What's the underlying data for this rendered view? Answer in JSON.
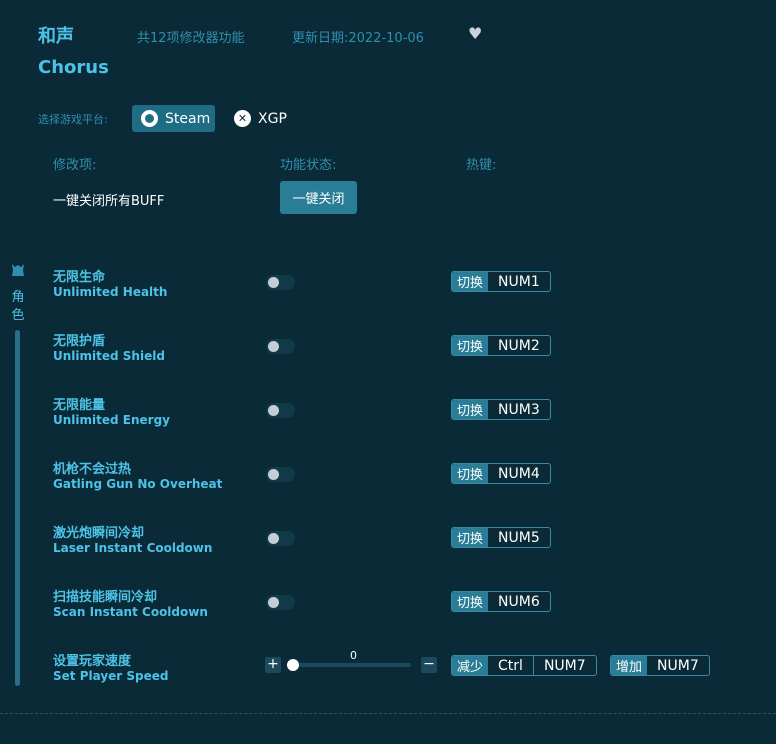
{
  "header": {
    "title_cn": "和声",
    "title_en": "Chorus",
    "feature_count": "共12项修改器功能",
    "update_date": "更新日期:2022-10-06",
    "favorite_icon": "heart-icon"
  },
  "platform": {
    "label": "选择游戏平台:",
    "options": [
      {
        "label": "Steam",
        "icon": "steam-icon",
        "selected": true
      },
      {
        "label": "XGP",
        "icon": "xbox-icon",
        "selected": false
      }
    ]
  },
  "columns": {
    "option": "修改项:",
    "status": "功能状态:",
    "hotkey": "热键:"
  },
  "global": {
    "label": "一键关闭所有BUFF",
    "button": "一键关闭"
  },
  "sidebar": {
    "icon": "character-icon",
    "label_1": "角",
    "label_2": "色"
  },
  "options": [
    {
      "cn": "无限生命",
      "en": "Unlimited Health",
      "on": false,
      "action": "切换",
      "key": "NUM1"
    },
    {
      "cn": "无限护盾",
      "en": "Unlimited Shield",
      "on": false,
      "action": "切换",
      "key": "NUM2"
    },
    {
      "cn": "无限能量",
      "en": "Unlimited Energy",
      "on": false,
      "action": "切换",
      "key": "NUM3"
    },
    {
      "cn": "机枪不会过热",
      "en": "Gatling Gun No Overheat",
      "on": false,
      "action": "切换",
      "key": "NUM4"
    },
    {
      "cn": "激光炮瞬间冷却",
      "en": "Laser Instant Cooldown",
      "on": false,
      "action": "切换",
      "key": "NUM5"
    },
    {
      "cn": "扫描技能瞬间冷却",
      "en": "Scan Instant Cooldown",
      "on": false,
      "action": "切换",
      "key": "NUM6"
    }
  ],
  "speed": {
    "cn": "设置玩家速度",
    "en": "Set Player Speed",
    "value": "0",
    "plus": "+",
    "minus": "−",
    "decrease": {
      "action": "减少",
      "mod": "Ctrl",
      "key": "NUM7"
    },
    "increase": {
      "action": "增加",
      "key": "NUM7"
    }
  },
  "colors": {
    "background": "#0b2a38",
    "accent": "#4cc3e6",
    "button": "#2a7d96"
  }
}
